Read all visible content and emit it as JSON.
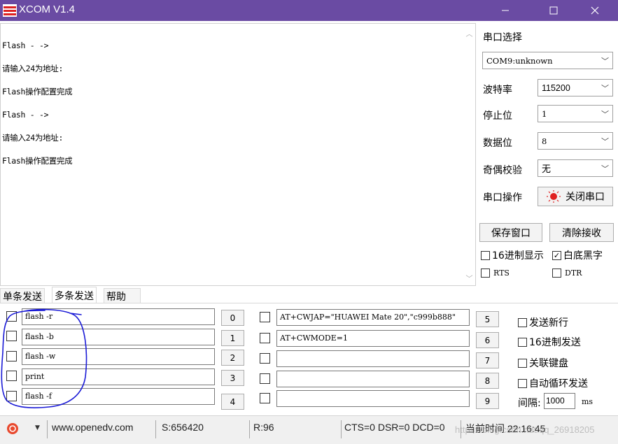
{
  "window": {
    "title": "XCOM V1.4",
    "accent": "#6a4ba3"
  },
  "receive": {
    "lines": [
      "Flash - ->",
      "请输入24为地址:",
      "Flash操作配置完成",
      "Flash - ->",
      "请输入24为地址:",
      "Flash操作配置完成"
    ]
  },
  "serial": {
    "section_title": "串口选择",
    "port": "COM9:unknown",
    "baud_label": "波特率",
    "baud": "115200",
    "stop_label": "停止位",
    "stop": "1",
    "data_label": "数据位",
    "data": "8",
    "parity_label": "奇偶校验",
    "parity": "无",
    "op_label": "串口操作",
    "op_button": "关闭串口",
    "save_window": "保存窗口",
    "clear_recv": "清除接收",
    "hex_display": "16进制显示",
    "white_bg": "白底黑字",
    "rts": "RTS",
    "dtr": "DTR"
  },
  "tabs": [
    "单条发送",
    "多条发送",
    "帮助"
  ],
  "commands_left": [
    {
      "text": "flash -r",
      "num": "0"
    },
    {
      "text": "flash -b",
      "num": "1"
    },
    {
      "text": "flash -w",
      "num": "2"
    },
    {
      "text": "print",
      "num": "3"
    },
    {
      "text": "flash -f",
      "num": "4"
    }
  ],
  "commands_right": [
    {
      "text": "AT+CWJAP=\"HUAWEI Mate 20\",\"c999b888\"",
      "num": "5"
    },
    {
      "text": "AT+CWMODE=1",
      "num": "6"
    },
    {
      "text": "",
      "num": "7"
    },
    {
      "text": "",
      "num": "8"
    },
    {
      "text": "",
      "num": "9"
    }
  ],
  "send_options": {
    "newline": "发送新行",
    "hex_send": "16进制发送",
    "link_keyboard": "关联键盘",
    "auto_loop": "自动循环发送",
    "interval_label": "间隔:",
    "interval_value": "1000",
    "interval_unit": "ms"
  },
  "status": {
    "url": "www.openedv.com",
    "sent": "S:656420",
    "recv": "R:96",
    "lines": "CTS=0 DSR=0 DCD=0",
    "time": "当前时间 22:16:45",
    "watermark": "https://blog.csdn.net/qq_26918205"
  },
  "colors": {
    "annotation": "#1a1ad6",
    "port_open": "#e02020"
  }
}
